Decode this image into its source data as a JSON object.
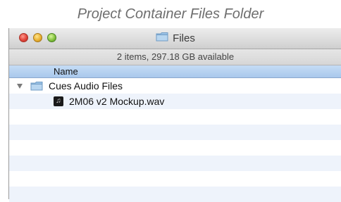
{
  "caption": "Project Container Files Folder",
  "window": {
    "title": "Files",
    "title_icon": "folder-icon",
    "status": "2 items, 297.18 GB available"
  },
  "list": {
    "column_header": "Name",
    "items": [
      {
        "label": "Cues Audio Files",
        "icon": "folder-icon",
        "expanded": true,
        "level": 0
      },
      {
        "label": "2M06 v2 Mockup.wav",
        "icon": "audio-file-icon",
        "level": 1
      }
    ]
  },
  "colors": {
    "header_blue": "#b9d3f0",
    "close": "#e0443a",
    "minimize": "#e9b132",
    "zoom": "#84c33f"
  }
}
